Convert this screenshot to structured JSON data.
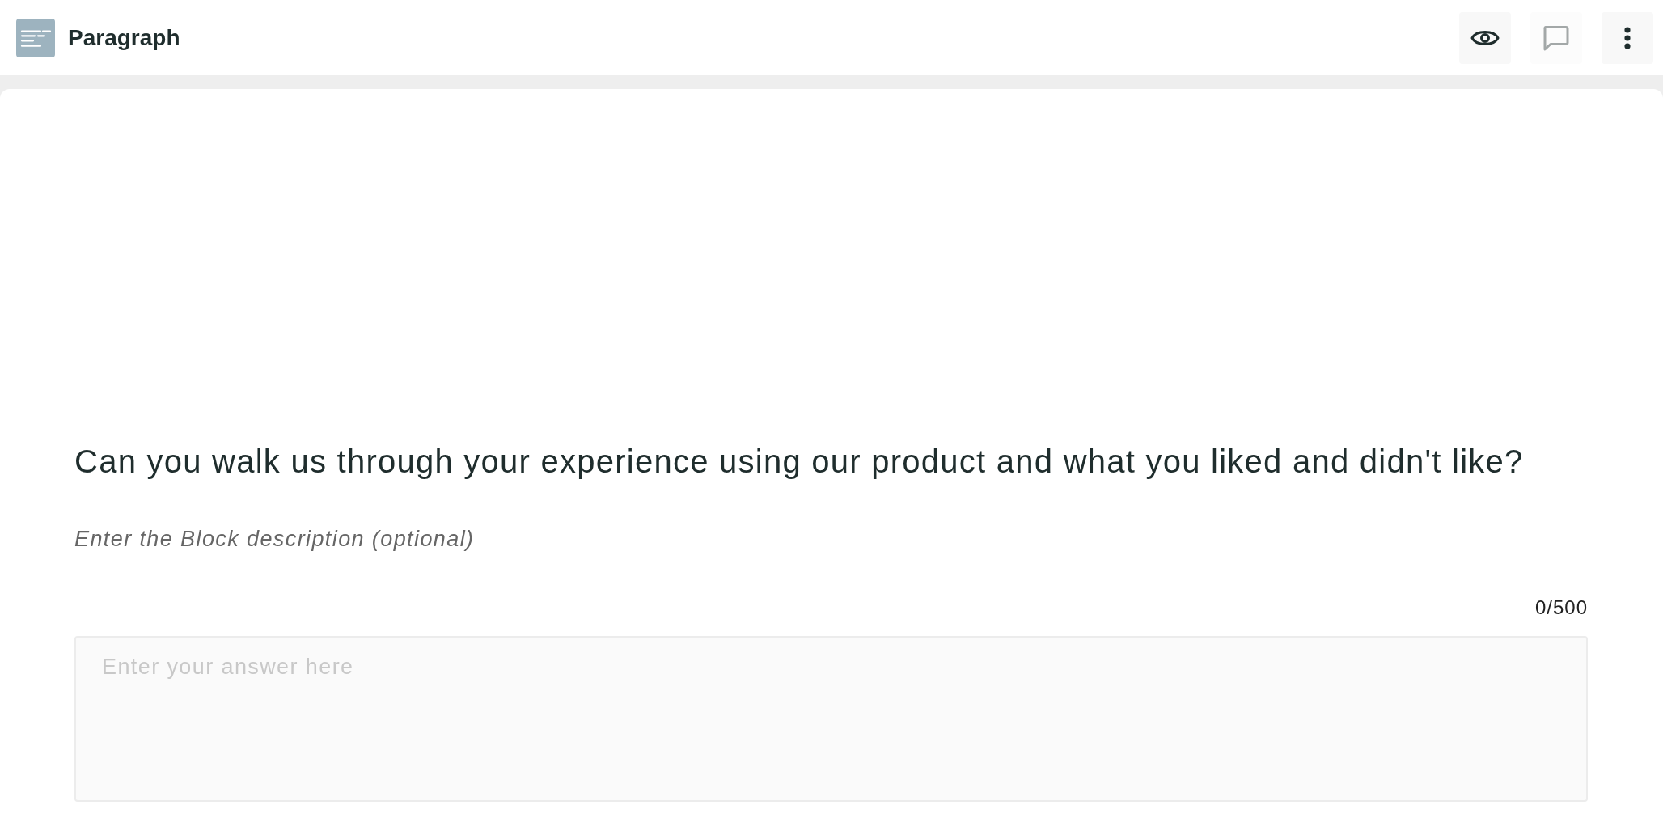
{
  "header": {
    "title": "Paragraph",
    "buttons": [
      {
        "kind": "preview",
        "disabled": false
      },
      {
        "kind": "comment",
        "disabled": true
      },
      {
        "kind": "more",
        "disabled": false
      }
    ]
  },
  "block": {
    "question": "Can you walk us through your experience using our product and what you liked and didn't like?",
    "description": {
      "placeholder": "Enter the Block description (optional)"
    },
    "counter": "0/500",
    "answer": {
      "placeholder": "Enter your answer here"
    }
  }
}
